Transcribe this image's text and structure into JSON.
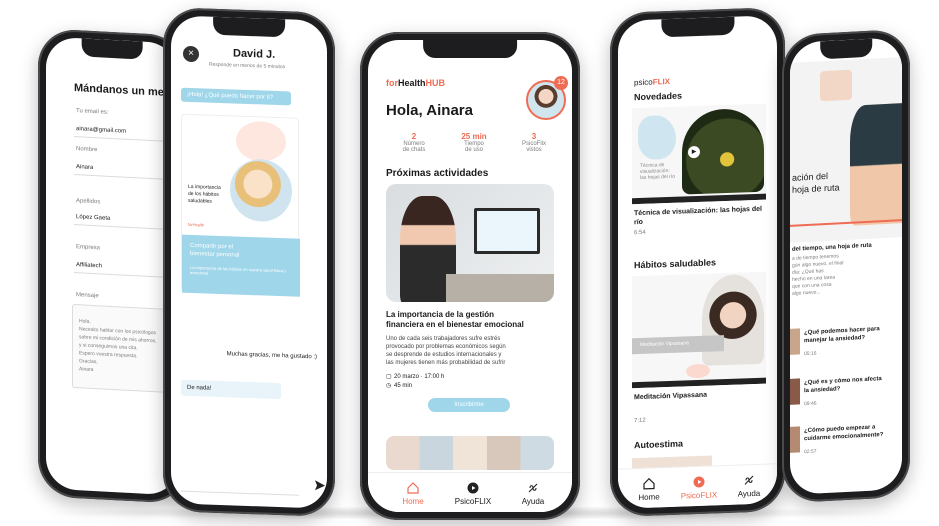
{
  "phone1": {
    "title": "Mándanos un mensaje",
    "fields": [
      {
        "label": "Tu email es:",
        "value": "ainara@gmail.com"
      },
      {
        "label": "Nombre",
        "value": "Ainara"
      },
      {
        "label": "Apellidos",
        "value": "López Gaeta"
      },
      {
        "label": "Empresa",
        "value": "Affiliatech"
      }
    ],
    "message_label": "Mensaje",
    "message_lines": [
      "Hola,",
      "Necesito hablar con los psicólogos",
      "sobre mi condición de mis ahorros,",
      "y si conseguimos una cita.",
      "Espero vuestra respuesta.",
      "Gracias,",
      "Ainara"
    ]
  },
  "phone2": {
    "close_icon": "close-icon",
    "name": "David J.",
    "subtitle": "Responde en menos de 5 minutos",
    "bubble1": "¡Hola! ¿Qué puedo hacer por ti?",
    "card_title_lines": [
      "La importancia",
      "de los hábitos",
      "saludables"
    ],
    "card_brand": "forHealth",
    "card_cta_lines": [
      "Compartir por el",
      "bienestar personal"
    ],
    "card_small": "La importancia de los hábitos en nuestra salud física y emocional",
    "reply": "Muchas gracias, me ha gustado :)",
    "answer": "De nada!",
    "send_icon": "send-icon"
  },
  "phone3": {
    "brand_prefix": "for",
    "brand_main": "Health",
    "brand_hub": "HUB",
    "badge_count": "12",
    "greeting": "Hola, Ainara",
    "stats": [
      {
        "value": "2",
        "label1": "Número",
        "label2": "de chats"
      },
      {
        "value": "25 min",
        "label1": "Tiempo",
        "label2": "de uso"
      },
      {
        "value": "3",
        "label1": "PsicoFlix",
        "label2": "vistos"
      }
    ],
    "section_title": "Próximas actividades",
    "card": {
      "title_lines": [
        "La importancia de la gestión",
        "financiera en el bienestar emocional"
      ],
      "desc_lines": [
        "Uno de cada seis trabajadores sufre estrés",
        "provocado por problemas económicos según",
        "se desprende de estudios internacionales y",
        "las mujeres tienen más probabilidad de sufrir"
      ],
      "date": "20 marzo · 17:00 h",
      "duration": "45 min",
      "button": "Inscribirme"
    },
    "nav": [
      {
        "label": "Home",
        "icon": "home-icon"
      },
      {
        "label": "PsicoFLIX",
        "icon": "play-icon"
      },
      {
        "label": "Ayuda",
        "icon": "help-icon"
      }
    ]
  },
  "phone4": {
    "brand_prefix": "psico",
    "brand_main": "FLIX",
    "section1": "Novedades",
    "video1_overlay_lines": [
      "Técnica de",
      "visualización:",
      "las hojas del río"
    ],
    "video1_title_lines": [
      "Técnica de visualización: las hojas del",
      "río"
    ],
    "video1_duration": "6:54",
    "section2": "Hábitos saludables",
    "video2_overlay": "Meditación Vipassana",
    "video2_title": "Meditación Vipassana",
    "video2_duration": "7:12",
    "section3": "Autoestima",
    "nav": [
      {
        "label": "Home",
        "icon": "home-icon"
      },
      {
        "label": "PsicoFLIX",
        "icon": "play-icon"
      },
      {
        "label": "Ayuda",
        "icon": "help-icon"
      }
    ]
  },
  "phone5": {
    "hero_lines": [
      "ación del",
      "hoja de ruta"
    ],
    "heading": "del tiempo, una hoja de ruta",
    "body_lines": [
      "a de tiempo tenemos",
      "gún algo nuevo, el final",
      "día: ¿Qué has",
      "hecho en una tarea",
      "que con una cosa",
      "algo nuevo..."
    ],
    "related": [
      {
        "title_lines": [
          "¿Qué podemos hacer para",
          "manejar la ansiedad?"
        ],
        "duration": "05:16"
      },
      {
        "title_lines": [
          "¿Qué es y cómo nos afecta",
          "la ansiedad?"
        ],
        "duration": "09:46"
      },
      {
        "title_lines": [
          "¿Cómo puedo empezar a",
          "cuidarme emocionalmente?"
        ],
        "duration": "02:57"
      }
    ]
  },
  "colors": {
    "coral": "#f06b54",
    "sky": "#9fd6ea",
    "frame": "#1d1d1f"
  }
}
